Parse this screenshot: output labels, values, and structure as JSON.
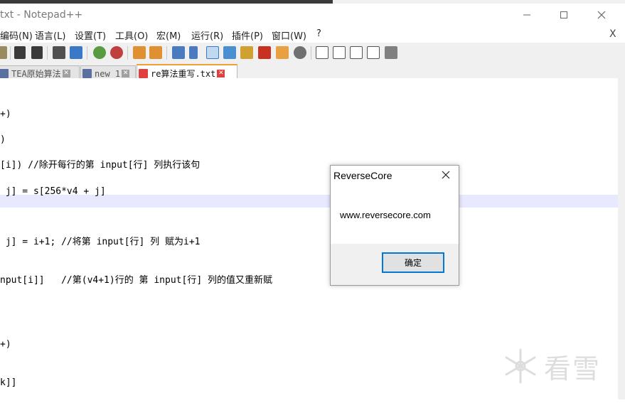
{
  "window": {
    "title": "txt - Notepad++"
  },
  "menu": {
    "items": [
      "编码(N)",
      "语言(L)",
      "设置(T)",
      "工具(O)",
      "宏(M)",
      "运行(R)",
      "插件(P)",
      "窗口(W)",
      "?"
    ],
    "close_x": "X"
  },
  "tabs": [
    {
      "label": "TEA原始算法",
      "close": "✕"
    },
    {
      "label": "new 1",
      "close": "✕"
    },
    {
      "label": "re算法重写.txt",
      "close": "✕"
    }
  ],
  "editor": {
    "lines": [
      "+)",
      ")",
      "[i]) //除开每行的第 input[行] 列执行该句",
      " j] = s[256*v4 + j]",
      "",
      " j] = i+1; //将第 input[行] 列 赋为i+1",
      "nput[i]]   //第(v4+1)行的 第 input[行] 列的值又重新赋",
      "+)",
      "k]]"
    ]
  },
  "dialog": {
    "title": "ReverseCore",
    "message": "www.reversecore.com",
    "ok_label": "确定"
  },
  "watermark": {
    "text": "看雪"
  },
  "colors": {
    "accent": "#0078d7",
    "current_line": "#e8e8ff",
    "tab_active_border": "#f0a030",
    "tab_close_active": "#e04040"
  }
}
